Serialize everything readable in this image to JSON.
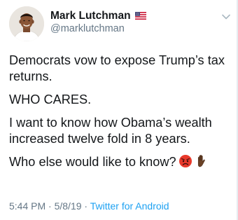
{
  "user": {
    "display_name": "Mark Lutchman",
    "handle": "@marklutchman",
    "flag_icon": "us-flag-icon"
  },
  "tweet": {
    "paragraphs": [
      "Democrats vow to expose Trump’s tax returns.",
      "WHO CARES.",
      "I want to know how Obama’s wealth increased twelve fold in 8 years.",
      "Who else would like to know?"
    ],
    "emojis": [
      "angry-face-icon",
      "raised-hand-icon"
    ]
  },
  "meta": {
    "time": "5:44 PM",
    "date": "5/8/19",
    "separator": "·",
    "source": "Twitter for Android"
  },
  "colors": {
    "text": "#14171a",
    "secondary": "#657786",
    "link": "#1da1f2"
  }
}
